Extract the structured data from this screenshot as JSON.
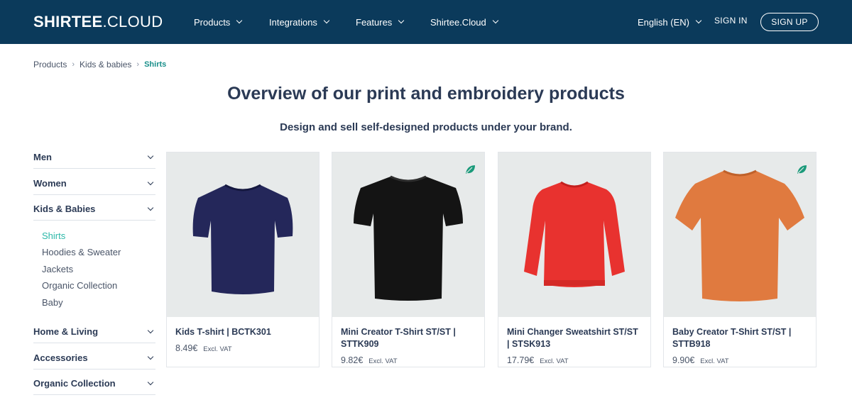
{
  "header": {
    "logo_bold": "SHIRTEE",
    "logo_thin": ".CLOUD",
    "nav": [
      "Products",
      "Integrations",
      "Features",
      "Shirtee.Cloud"
    ],
    "language": "English (EN)",
    "sign_in": "SIGN IN",
    "sign_up": "SIGN UP"
  },
  "breadcrumb": {
    "items": [
      "Products",
      "Kids & babies"
    ],
    "current": "Shirts",
    "separator": "›"
  },
  "main": {
    "title": "Overview of our print and embroidery products",
    "subtitle": "Design and sell self-designed products under your brand."
  },
  "sidebar": {
    "categories": [
      "Men",
      "Women",
      "Kids & Babies",
      "Home & Living",
      "Accessories",
      "Organic Collection"
    ],
    "subcategories": [
      "Shirts",
      "Hoodies & Sweater",
      "Jackets",
      "Organic Collection",
      "Baby"
    ],
    "active_subcategory": "Shirts"
  },
  "products": [
    {
      "name": "Kids T-shirt | BCTK301",
      "price": "8.49€",
      "vat": "Excl. VAT",
      "color": "#24275a",
      "icon": "tshirt-icon",
      "eco": false
    },
    {
      "name": "Mini Creator T-Shirt ST/ST | STTK909",
      "price": "9.82€",
      "vat": "Excl. VAT",
      "color": "#141414",
      "icon": "tshirt-icon",
      "eco": true
    },
    {
      "name": "Mini Changer Sweatshirt ST/ST | STSK913",
      "price": "17.79€",
      "vat": "Excl. VAT",
      "color": "#e8322f",
      "icon": "sweatshirt-icon",
      "eco": false
    },
    {
      "name": "Baby Creator T-Shirt ST/ST | STTB918",
      "price": "9.90€",
      "vat": "Excl. VAT",
      "color": "#e07a3f",
      "icon": "tshirt-icon",
      "eco": true
    }
  ],
  "colors": {
    "header_bg": "#0b3a5b",
    "accent": "#2bb8a8",
    "eco_leaf": "#1a9a7a"
  }
}
